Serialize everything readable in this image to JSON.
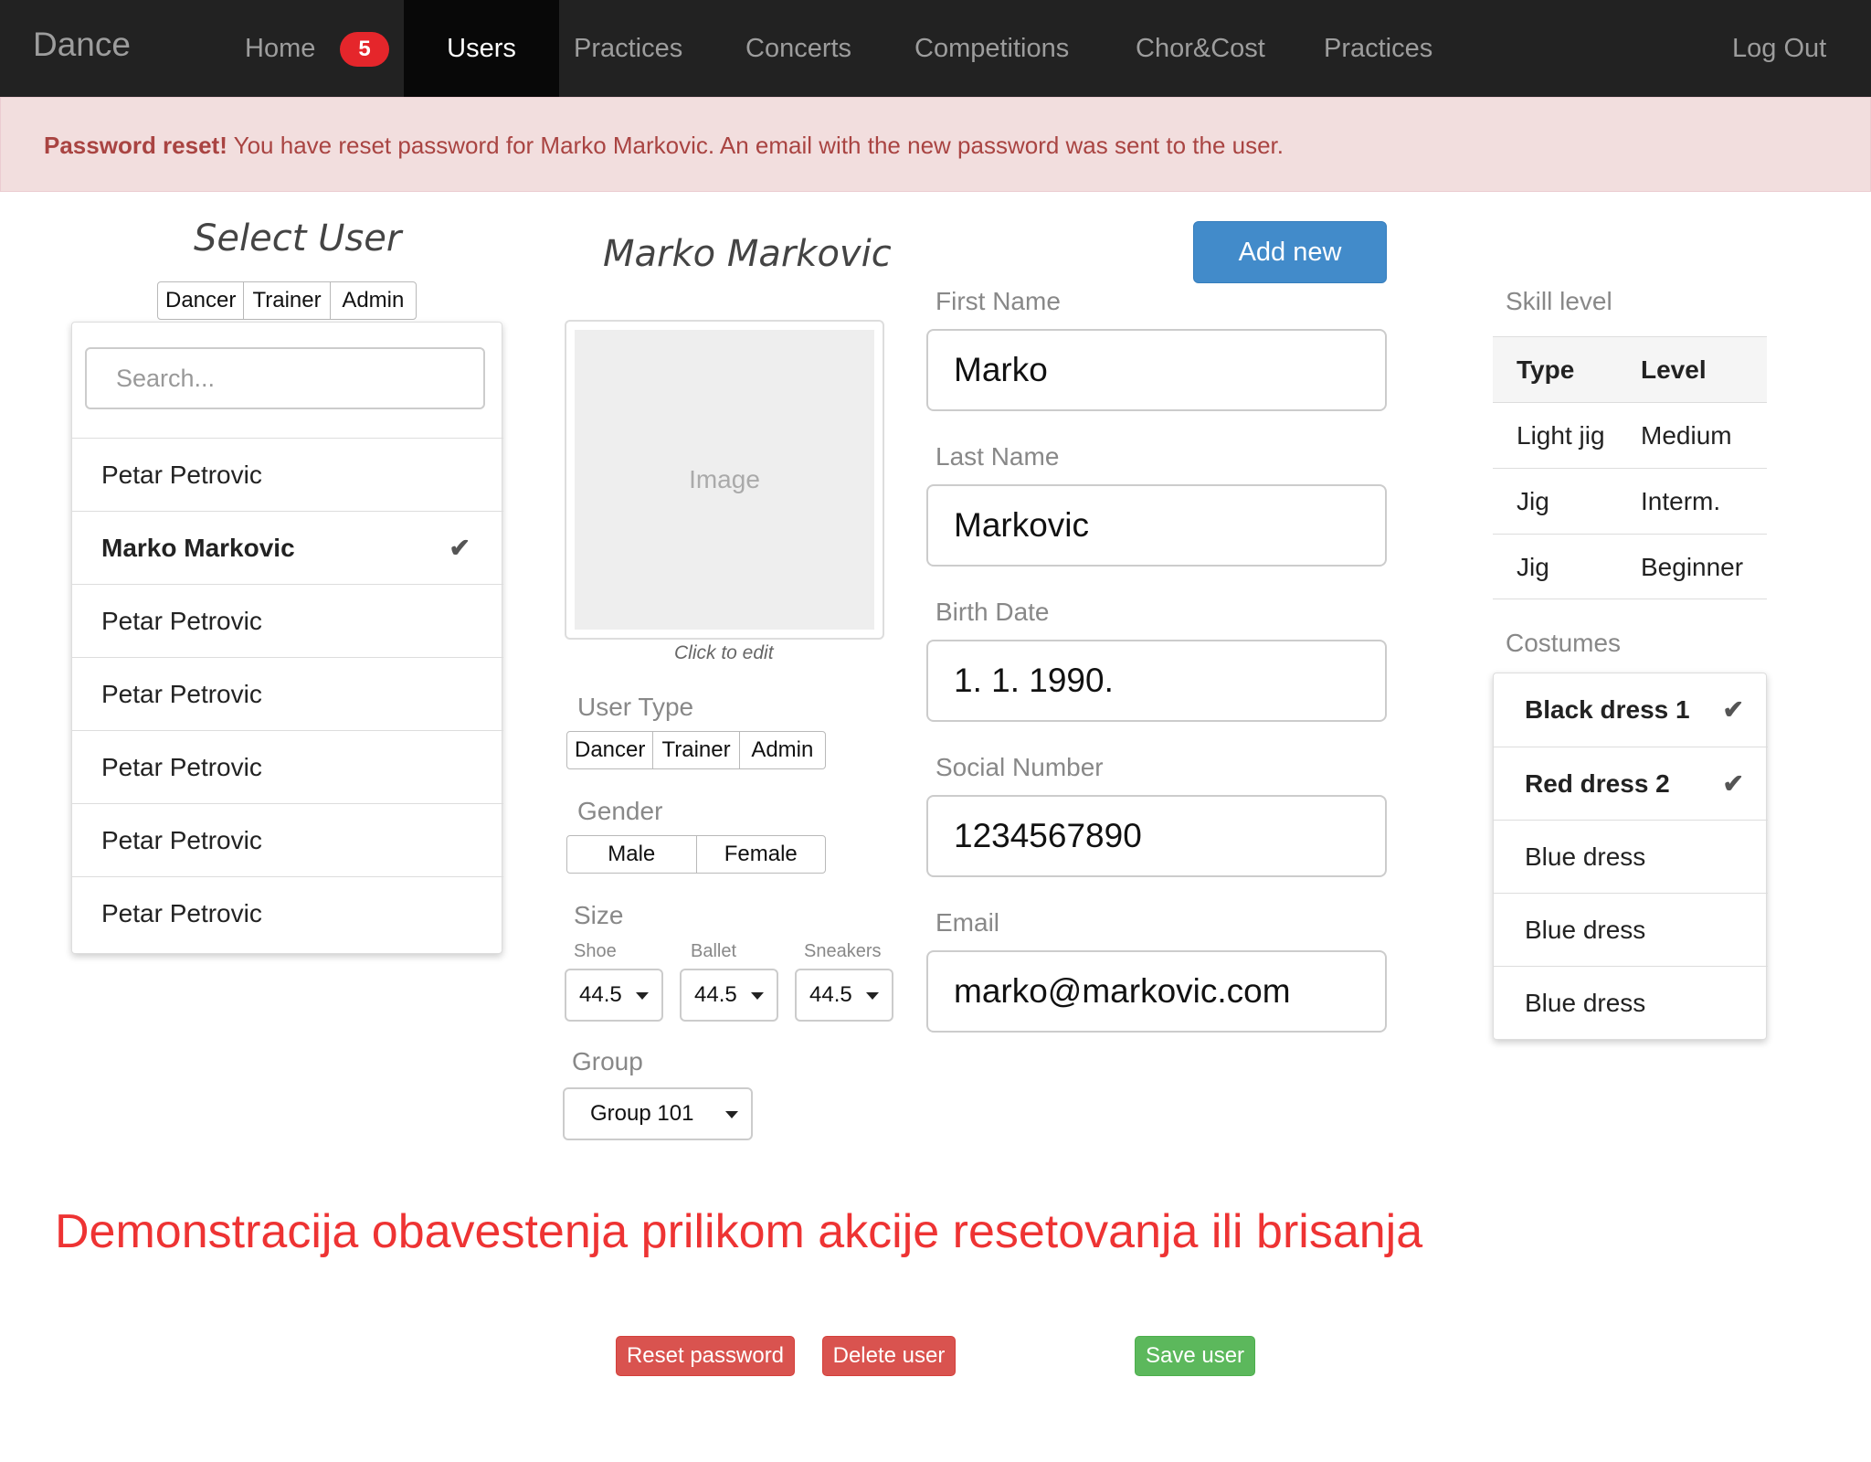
{
  "navbar": {
    "brand": "Dance",
    "items": [
      {
        "label": "Home",
        "badge": "5"
      },
      {
        "label": "Users",
        "active": true
      },
      {
        "label": "Practices"
      },
      {
        "label": "Concerts"
      },
      {
        "label": "Competitions"
      },
      {
        "label": "Chor&Cost"
      },
      {
        "label": "Practices"
      }
    ],
    "logout": "Log Out"
  },
  "alert": {
    "strong": "Password reset!",
    "message": " You have reset password for Marko Markovic. An email with the new password was sent to the user."
  },
  "select_user": {
    "title": "Select User",
    "filters": [
      "Dancer",
      "Trainer",
      "Admin"
    ],
    "search_placeholder": "Search...",
    "users": [
      {
        "name": "Petar Petrovic",
        "selected": false
      },
      {
        "name": "Marko Markovic",
        "selected": true
      },
      {
        "name": "Petar Petrovic",
        "selected": false
      },
      {
        "name": "Petar Petrovic",
        "selected": false
      },
      {
        "name": "Petar Petrovic",
        "selected": false
      },
      {
        "name": "Petar Petrovic",
        "selected": false
      },
      {
        "name": "Petar Petrovic",
        "selected": false
      }
    ]
  },
  "profile": {
    "name": "Marko Markovic",
    "image_placeholder": "Image",
    "image_caption": "Click to edit",
    "user_type": {
      "label": "User Type",
      "options": [
        "Dancer",
        "Trainer",
        "Admin"
      ]
    },
    "gender": {
      "label": "Gender",
      "options": [
        "Male",
        "Female"
      ]
    },
    "size": {
      "label": "Size",
      "shoe": {
        "label": "Shoe",
        "value": "44.5"
      },
      "ballet": {
        "label": "Ballet",
        "value": "44.5"
      },
      "sneakers": {
        "label": "Sneakers",
        "value": "44.5"
      }
    },
    "group": {
      "label": "Group",
      "value": "Group 101"
    }
  },
  "form": {
    "add_new": "Add new",
    "first_name": {
      "label": "First Name",
      "value": "Marko"
    },
    "last_name": {
      "label": "Last Name",
      "value": "Markovic"
    },
    "birth_date": {
      "label": "Birth Date",
      "value": "1. 1. 1990."
    },
    "social_number": {
      "label": "Social Number",
      "value": "1234567890"
    },
    "email": {
      "label": "Email",
      "value": "marko@markovic.com"
    }
  },
  "skill_level": {
    "label": "Skill level",
    "headers": [
      "Type",
      "Level"
    ],
    "rows": [
      [
        "Light jig",
        "Medium"
      ],
      [
        "Jig",
        "Interm."
      ],
      [
        "Jig",
        "Beginner"
      ]
    ]
  },
  "costumes": {
    "label": "Costumes",
    "items": [
      {
        "name": "Black dress 1",
        "selected": true
      },
      {
        "name": "Red dress 2",
        "selected": true
      },
      {
        "name": "Blue dress",
        "selected": false
      },
      {
        "name": "Blue dress",
        "selected": false
      },
      {
        "name": "Blue dress",
        "selected": false
      }
    ]
  },
  "demo_note": "Demonstracija obavestenja prilikom akcije resetovanja ili brisanja",
  "actions": {
    "reset_password": "Reset password",
    "delete_user": "Delete user",
    "save_user": "Save user"
  }
}
